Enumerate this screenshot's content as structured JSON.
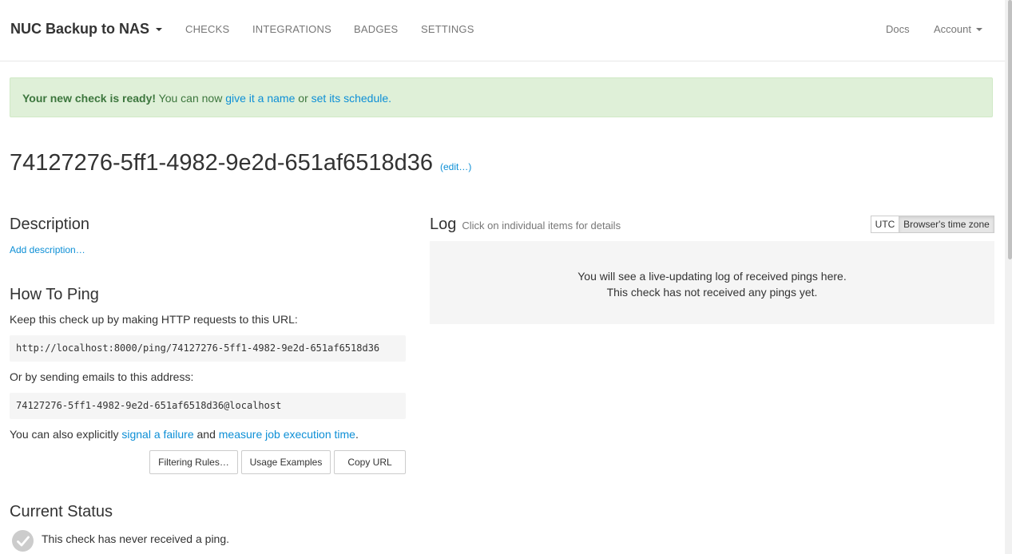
{
  "navbar": {
    "project_name": "NUC Backup to NAS",
    "links": [
      "CHECKS",
      "INTEGRATIONS",
      "BADGES",
      "SETTINGS"
    ],
    "docs": "Docs",
    "account": "Account"
  },
  "alert": {
    "strong": "Your new check is ready!",
    "text1": " You can now ",
    "link1": "give it a name",
    "text2": " or ",
    "link2": "set its schedule."
  },
  "check": {
    "uuid": "74127276-5ff1-4982-9e2d-651af6518d36",
    "edit_label": "(edit…)"
  },
  "description": {
    "heading": "Description",
    "add_link": "Add description…"
  },
  "how_to_ping": {
    "heading": "How To Ping",
    "http_intro": "Keep this check up by making HTTP requests to this URL:",
    "ping_url": "http://localhost:8000/ping/74127276-5ff1-4982-9e2d-651af6518d36",
    "email_intro": "Or by sending emails to this address:",
    "email": "74127276-5ff1-4982-9e2d-651af6518d36@localhost",
    "also_text1": "You can also explicitly ",
    "also_link1": "signal a failure",
    "also_text2": " and ",
    "also_link2": "measure job execution time",
    "also_text3": ".",
    "buttons": {
      "filtering": "Filtering Rules…",
      "usage": "Usage Examples",
      "copy": "Copy URL"
    }
  },
  "current_status": {
    "heading": "Current Status",
    "text": "This check has never received a ping."
  },
  "log": {
    "heading": "Log",
    "subtitle": "Click on individual items for details",
    "tz_utc": "UTC",
    "tz_browser": "Browser's time zone",
    "empty_line1": "You will see a live-updating log of received pings here.",
    "empty_line2": "This check has not received any pings yet."
  }
}
